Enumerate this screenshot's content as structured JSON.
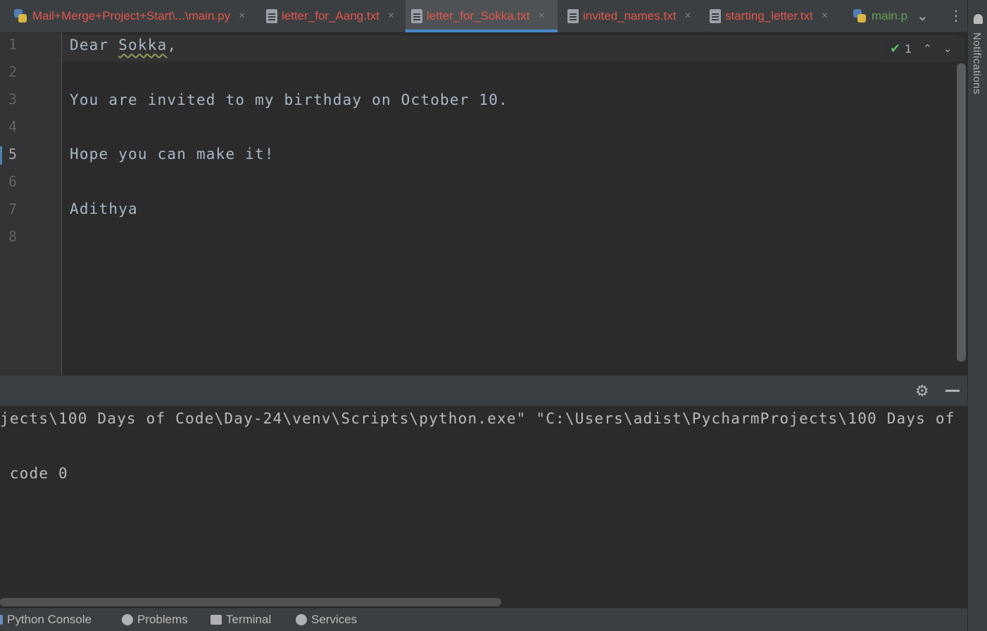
{
  "tabs": [
    {
      "label": "Mail+Merge+Project+Start\\...\\main.py",
      "icon": "python-file-icon",
      "closable": true,
      "active": false
    },
    {
      "label": "letter_for_Aang.txt",
      "icon": "text-file-icon",
      "closable": true,
      "active": false
    },
    {
      "label": "letter_for_Sokka.txt",
      "icon": "text-file-icon",
      "closable": true,
      "active": true
    },
    {
      "label": "invited_names.txt",
      "icon": "text-file-icon",
      "closable": true,
      "active": false
    },
    {
      "label": "starting_letter.txt",
      "icon": "text-file-icon",
      "closable": true,
      "active": false
    },
    {
      "label": "main.p",
      "icon": "python-file-icon",
      "closable": false,
      "active": false
    }
  ],
  "tab_close_glyph": "×",
  "tab_overflow_icon": "chevron-down-icon",
  "tab_menu_icon": "more-vertical-icon",
  "notifications_label": "Notifications",
  "editor": {
    "line_numbers": [
      "1",
      "2",
      "3",
      "4",
      "5",
      "6",
      "7",
      "8"
    ],
    "current_line": "5",
    "lines": [
      {
        "pre": "Dear ",
        "squiggle": "Sokka",
        "post": ","
      },
      {
        "text": ""
      },
      {
        "text": "You are invited to my birthday on October 10."
      },
      {
        "text": ""
      },
      {
        "text": "Hope you can make it!"
      },
      {
        "text": ""
      },
      {
        "text": "Adithya"
      },
      {
        "text": ""
      }
    ],
    "inspection_count": "1"
  },
  "console": {
    "lines": [
      "jects\\100 Days of Code\\Day-24\\venv\\Scripts\\python.exe\" \"C:\\Users\\adist\\PycharmProjects\\100 Days of",
      " code 0"
    ]
  },
  "tool_windows": [
    {
      "label": "Python Console",
      "icon": "python-console-icon"
    },
    {
      "label": "Problems",
      "icon": "problems-icon"
    },
    {
      "label": "Terminal",
      "icon": "terminal-icon"
    },
    {
      "label": "Services",
      "icon": "services-icon"
    }
  ],
  "colors": {
    "tab_text": "#e0574f",
    "active_tab_underline": "#4a88c7",
    "editor_bg": "#2b2b2b",
    "panel_bg": "#3c3f41",
    "text": "#a9b7c6"
  }
}
